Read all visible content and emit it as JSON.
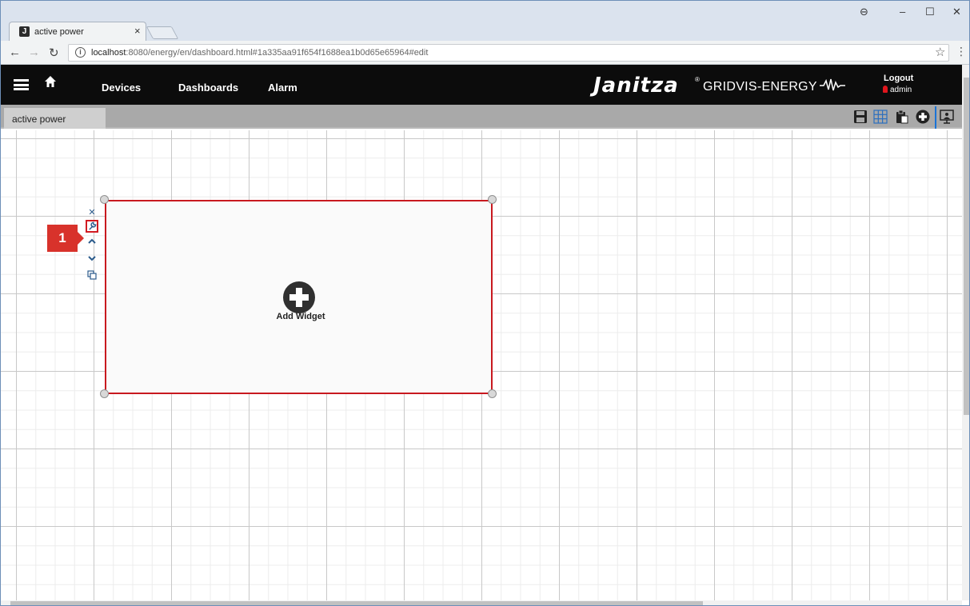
{
  "browser": {
    "tab_title": "active power",
    "tab_favicon": "J",
    "tab_close": "×",
    "url_host": "localhost",
    "url_rest": ":8080/energy/en/dashboard.html#1a335aa91f654f1688ea1b0d65e65964#edit",
    "window_controls": {
      "profile": "⊖",
      "minimize": "–",
      "maximize": "☐",
      "close": "✕"
    }
  },
  "header": {
    "nav": {
      "devices": "Devices",
      "dashboards": "Dashboards",
      "alarm": "Alarm"
    },
    "brand": "Janitza",
    "brand_mark": "®",
    "product": "GRIDVIS-ENERGY",
    "logout": "Logout",
    "user": "admin"
  },
  "dashboard": {
    "tab": "active power",
    "toolbar_icons": [
      "save-icon",
      "grid-icon",
      "paste-icon",
      "add-icon",
      "presentation-icon"
    ]
  },
  "widget": {
    "add_label": "Add Widget",
    "side_controls": [
      "close-icon",
      "wrench-icon",
      "move-up-icon",
      "move-down-icon",
      "copy-icon"
    ]
  },
  "annotation": {
    "step": "1"
  },
  "colors": {
    "accent": "#d11b22",
    "header_bg": "#0c0c0c",
    "toolbar_bg": "#a9a9a9",
    "icon_blue": "#2b5b8c"
  }
}
